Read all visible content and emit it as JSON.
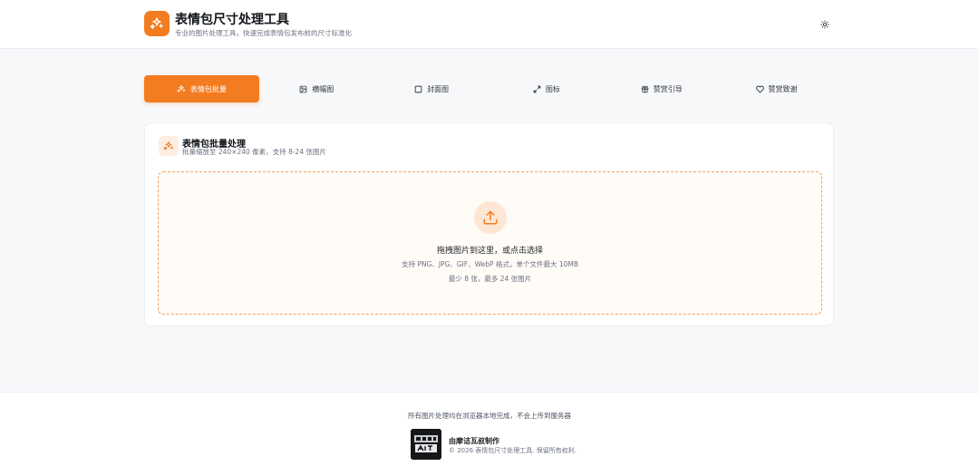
{
  "header": {
    "title": "表情包尺寸处理工具",
    "subtitle": "专业的图片处理工具，快速完成表情包发布前的尺寸标准化",
    "logo_icon": "sparkles-icon",
    "theme_toggle_icon": "sun-icon"
  },
  "tabs": [
    {
      "label": "表情包批量",
      "icon": "sparkles-icon",
      "active": true
    },
    {
      "label": "横幅图",
      "icon": "image-icon",
      "active": false
    },
    {
      "label": "封面图",
      "icon": "square-icon",
      "active": false
    },
    {
      "label": "图标",
      "icon": "expand-icon",
      "active": false
    },
    {
      "label": "赞赏引导",
      "icon": "gift-icon",
      "active": false
    },
    {
      "label": "赞赏致谢",
      "icon": "heart-icon",
      "active": false
    }
  ],
  "card": {
    "title": "表情包批量处理",
    "description": "批量缩放至 240×240 像素，支持 8-24 张图片",
    "dropzone": {
      "title": "拖拽图片到这里，或点击选择",
      "formats": "支持 PNG、JPG、GIF、WebP 格式，单个文件最大 10MB",
      "count": "最少 8 张，最多 24 张图片"
    }
  },
  "footer": {
    "privacy": "所有图片处理均在浏览器本地完成，不会上传到服务器",
    "author": "由摩诘瓦叔制作",
    "copyright": "© 2026 表情包尺寸处理工具. 保留所有权利."
  },
  "colors": {
    "accent": "#f47c20",
    "accent_light": "#fdeee1",
    "background": "#f7f8fa"
  }
}
